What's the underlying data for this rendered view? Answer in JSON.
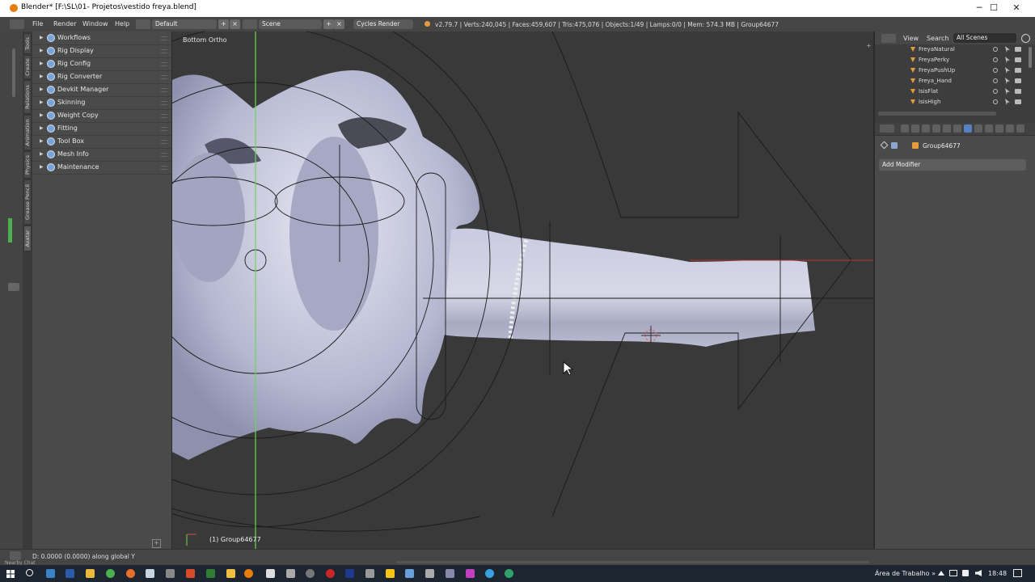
{
  "window": {
    "title": "Blender* [F:\\SL\\01- Projetos\\vestido freya.blend]",
    "minimize": "─",
    "maximize": "☐",
    "close": "✕"
  },
  "header": {
    "menus": [
      "File",
      "Render",
      "Window",
      "Help"
    ],
    "layout": "Default",
    "scene": "Scene",
    "engine": "Cycles Render",
    "stats": "v2.79.7 | Verts:240,045 | Faces:459,607 | Tris:475,076 | Objects:1/49 | Lamps:0/0 | Mem: 574.3 MB | Group64677"
  },
  "tool_tabs": [
    "Tools",
    "Create",
    "Relations",
    "Animation",
    "Physics",
    "Grease Pencil",
    "Avatar"
  ],
  "toolshelf": {
    "items": [
      "Workflows",
      "Rig Display",
      "Rig Config",
      "Rig Converter",
      "Devkit Manager",
      "Skinning",
      "Weight Copy",
      "Fitting",
      "Tool Box",
      "Mesh Info",
      "Maintenance"
    ]
  },
  "viewport": {
    "view_label": "Bottom Ortho",
    "object_label": "(1) Group64677"
  },
  "outliner": {
    "view_menu": "View",
    "search_menu": "Search",
    "filter": "All Scenes",
    "rows": [
      "FreyaNatural",
      "FreyaPerky",
      "FreyaPushUp",
      "Freya_Hand",
      "IsisFlat",
      "IsisHigh"
    ]
  },
  "properties": {
    "object_name": "Group64677",
    "add_modifier": "Add Modifier"
  },
  "status": {
    "text": "D: 0.0000 (0.0000) along global Y"
  },
  "taskbar": {
    "nearby": "Nearby Chat",
    "tray_label": "Área de Trabalho",
    "tray_chevron": "»",
    "time": "18:48"
  },
  "colors": {
    "accent_blue": "#5680c2",
    "mesh": "#b9bcd6",
    "axis_green": "#6bd84e",
    "axis_red": "#d54a4a"
  }
}
